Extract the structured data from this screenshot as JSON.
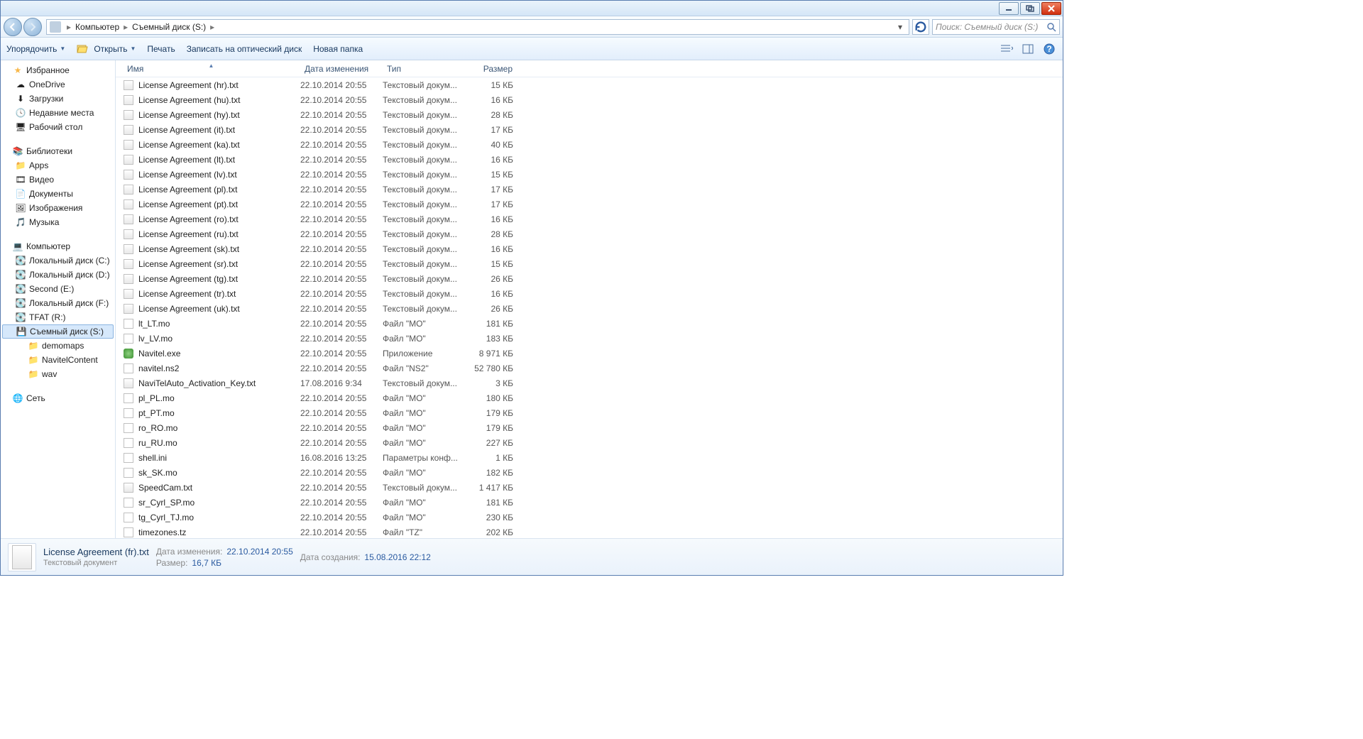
{
  "breadcrumb": [
    "Компьютер",
    "Съемный диск (S:)"
  ],
  "search_placeholder": "Поиск: Съемный диск (S:)",
  "toolbar": {
    "organize": "Упорядочить",
    "open": "Открыть",
    "print": "Печать",
    "burn": "Записать на оптический диск",
    "newfolder": "Новая папка"
  },
  "sidebar": {
    "favorites": {
      "label": "Избранное",
      "items": [
        "OneDrive",
        "Загрузки",
        "Недавние места",
        "Рабочий стол"
      ]
    },
    "libraries": {
      "label": "Библиотеки",
      "items": [
        "Apps",
        "Видео",
        "Документы",
        "Изображения",
        "Музыка"
      ]
    },
    "computer": {
      "label": "Компьютер",
      "items": [
        "Локальный диск (C:)",
        "Локальный диск (D:)",
        "Second (E:)",
        "Локальный диск (F:)",
        "TFAT (R:)",
        "Съемный диск (S:)"
      ],
      "sub": [
        "demomaps",
        "NavitelContent",
        "wav"
      ]
    },
    "network": {
      "label": "Сеть"
    }
  },
  "columns": {
    "name": "Имя",
    "date": "Дата изменения",
    "type": "Тип",
    "size": "Размер"
  },
  "files": [
    {
      "icon": "txt",
      "name": "License Agreement (hr).txt",
      "date": "22.10.2014 20:55",
      "type": "Текстовый докум...",
      "size": "15 КБ"
    },
    {
      "icon": "txt",
      "name": "License Agreement (hu).txt",
      "date": "22.10.2014 20:55",
      "type": "Текстовый докум...",
      "size": "16 КБ"
    },
    {
      "icon": "txt",
      "name": "License Agreement (hy).txt",
      "date": "22.10.2014 20:55",
      "type": "Текстовый докум...",
      "size": "28 КБ"
    },
    {
      "icon": "txt",
      "name": "License Agreement (it).txt",
      "date": "22.10.2014 20:55",
      "type": "Текстовый докум...",
      "size": "17 КБ"
    },
    {
      "icon": "txt",
      "name": "License Agreement (ka).txt",
      "date": "22.10.2014 20:55",
      "type": "Текстовый докум...",
      "size": "40 КБ"
    },
    {
      "icon": "txt",
      "name": "License Agreement (lt).txt",
      "date": "22.10.2014 20:55",
      "type": "Текстовый докум...",
      "size": "16 КБ"
    },
    {
      "icon": "txt",
      "name": "License Agreement (lv).txt",
      "date": "22.10.2014 20:55",
      "type": "Текстовый докум...",
      "size": "15 КБ"
    },
    {
      "icon": "txt",
      "name": "License Agreement (pl).txt",
      "date": "22.10.2014 20:55",
      "type": "Текстовый докум...",
      "size": "17 КБ"
    },
    {
      "icon": "txt",
      "name": "License Agreement (pt).txt",
      "date": "22.10.2014 20:55",
      "type": "Текстовый докум...",
      "size": "17 КБ"
    },
    {
      "icon": "txt",
      "name": "License Agreement (ro).txt",
      "date": "22.10.2014 20:55",
      "type": "Текстовый докум...",
      "size": "16 КБ"
    },
    {
      "icon": "txt",
      "name": "License Agreement (ru).txt",
      "date": "22.10.2014 20:55",
      "type": "Текстовый докум...",
      "size": "28 КБ"
    },
    {
      "icon": "txt",
      "name": "License Agreement (sk).txt",
      "date": "22.10.2014 20:55",
      "type": "Текстовый докум...",
      "size": "16 КБ"
    },
    {
      "icon": "txt",
      "name": "License Agreement (sr).txt",
      "date": "22.10.2014 20:55",
      "type": "Текстовый докум...",
      "size": "15 КБ"
    },
    {
      "icon": "txt",
      "name": "License Agreement (tg).txt",
      "date": "22.10.2014 20:55",
      "type": "Текстовый докум...",
      "size": "26 КБ"
    },
    {
      "icon": "txt",
      "name": "License Agreement (tr).txt",
      "date": "22.10.2014 20:55",
      "type": "Текстовый докум...",
      "size": "16 КБ"
    },
    {
      "icon": "txt",
      "name": "License Agreement (uk).txt",
      "date": "22.10.2014 20:55",
      "type": "Текстовый докум...",
      "size": "26 КБ"
    },
    {
      "icon": "file",
      "name": "lt_LT.mo",
      "date": "22.10.2014 20:55",
      "type": "Файл \"MO\"",
      "size": "181 КБ"
    },
    {
      "icon": "file",
      "name": "lv_LV.mo",
      "date": "22.10.2014 20:55",
      "type": "Файл \"MO\"",
      "size": "183 КБ"
    },
    {
      "icon": "exe",
      "name": "Navitel.exe",
      "date": "22.10.2014 20:55",
      "type": "Приложение",
      "size": "8 971 КБ"
    },
    {
      "icon": "file",
      "name": "navitel.ns2",
      "date": "22.10.2014 20:55",
      "type": "Файл \"NS2\"",
      "size": "52 780 КБ"
    },
    {
      "icon": "txt",
      "name": "NaviTelAuto_Activation_Key.txt",
      "date": "17.08.2016 9:34",
      "type": "Текстовый докум...",
      "size": "3 КБ"
    },
    {
      "icon": "file",
      "name": "pl_PL.mo",
      "date": "22.10.2014 20:55",
      "type": "Файл \"MO\"",
      "size": "180 КБ"
    },
    {
      "icon": "file",
      "name": "pt_PT.mo",
      "date": "22.10.2014 20:55",
      "type": "Файл \"MO\"",
      "size": "179 КБ"
    },
    {
      "icon": "file",
      "name": "ro_RO.mo",
      "date": "22.10.2014 20:55",
      "type": "Файл \"MO\"",
      "size": "179 КБ"
    },
    {
      "icon": "file",
      "name": "ru_RU.mo",
      "date": "22.10.2014 20:55",
      "type": "Файл \"MO\"",
      "size": "227 КБ"
    },
    {
      "icon": "file",
      "name": "shell.ini",
      "date": "16.08.2016 13:25",
      "type": "Параметры конф...",
      "size": "1 КБ"
    },
    {
      "icon": "file",
      "name": "sk_SK.mo",
      "date": "22.10.2014 20:55",
      "type": "Файл \"MO\"",
      "size": "182 КБ"
    },
    {
      "icon": "txt",
      "name": "SpeedCam.txt",
      "date": "22.10.2014 20:55",
      "type": "Текстовый докум...",
      "size": "1 417 КБ"
    },
    {
      "icon": "file",
      "name": "sr_Cyrl_SP.mo",
      "date": "22.10.2014 20:55",
      "type": "Файл \"MO\"",
      "size": "181 КБ"
    },
    {
      "icon": "file",
      "name": "tg_Cyrl_TJ.mo",
      "date": "22.10.2014 20:55",
      "type": "Файл \"MO\"",
      "size": "230 КБ"
    },
    {
      "icon": "file",
      "name": "timezones.tz",
      "date": "22.10.2014 20:55",
      "type": "Файл \"TZ\"",
      "size": "202 КБ"
    }
  ],
  "details": {
    "filename": "License Agreement (fr).txt",
    "filetype": "Текстовый документ",
    "modified_label": "Дата изменения:",
    "modified_value": "22.10.2014 20:55",
    "size_label": "Размер:",
    "size_value": "16,7 КБ",
    "created_label": "Дата создания:",
    "created_value": "15.08.2016 22:12"
  }
}
